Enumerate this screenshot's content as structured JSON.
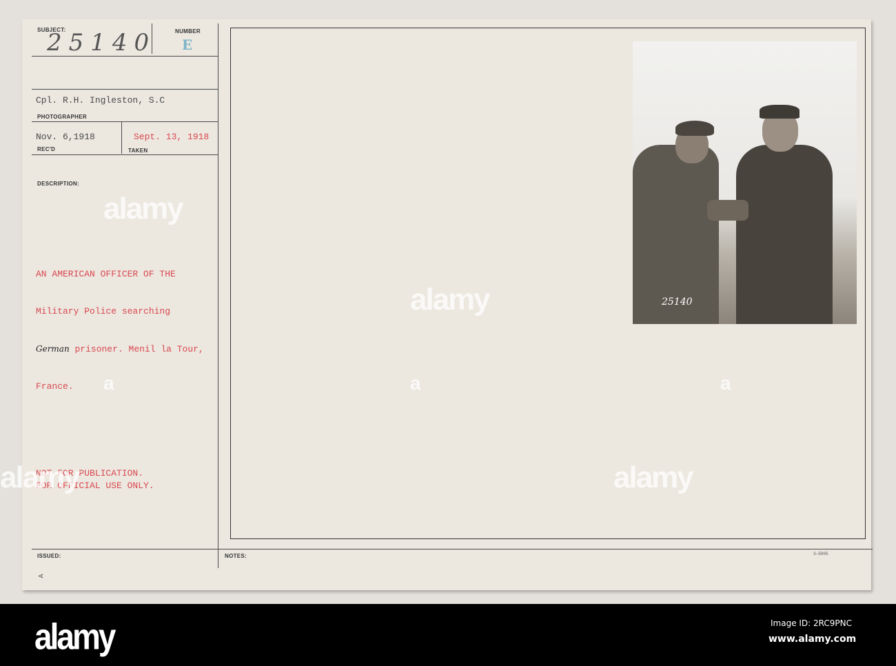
{
  "card": {
    "subject_label": "SUBJECT:",
    "subject_value": "25140",
    "number_label": "NUMBER",
    "number_value": "E",
    "photographer": "Cpl. R.H. Ingleston, S.C",
    "photographer_label": "PHOTOGRAPHER",
    "received": "Nov. 6,1918",
    "received_label": "REC'D",
    "taken": "Sept. 13, 1918",
    "taken_label": "TAKEN",
    "description_label": "DESCRIPTION:",
    "description_lines": [
      "AN AMERICAN OFFICER OF THE",
      "Military Police searching",
      "prisoner. Menil la Tour,",
      "France."
    ],
    "handwritten_word": "German",
    "notice_lines": [
      "NOT FOR PUBLICATION.",
      "FOR OFFICIAL USE ONLY."
    ],
    "issued_label": "ISSUED:",
    "notes_label": "NOTES:",
    "form_number": "3—5005",
    "corner_mark": "A",
    "photo_stamp": "25140"
  },
  "watermark": "alamy",
  "footer": {
    "logo": "alamy",
    "image_id": "Image ID: 2RC9PNC",
    "url": "www.alamy.com"
  }
}
